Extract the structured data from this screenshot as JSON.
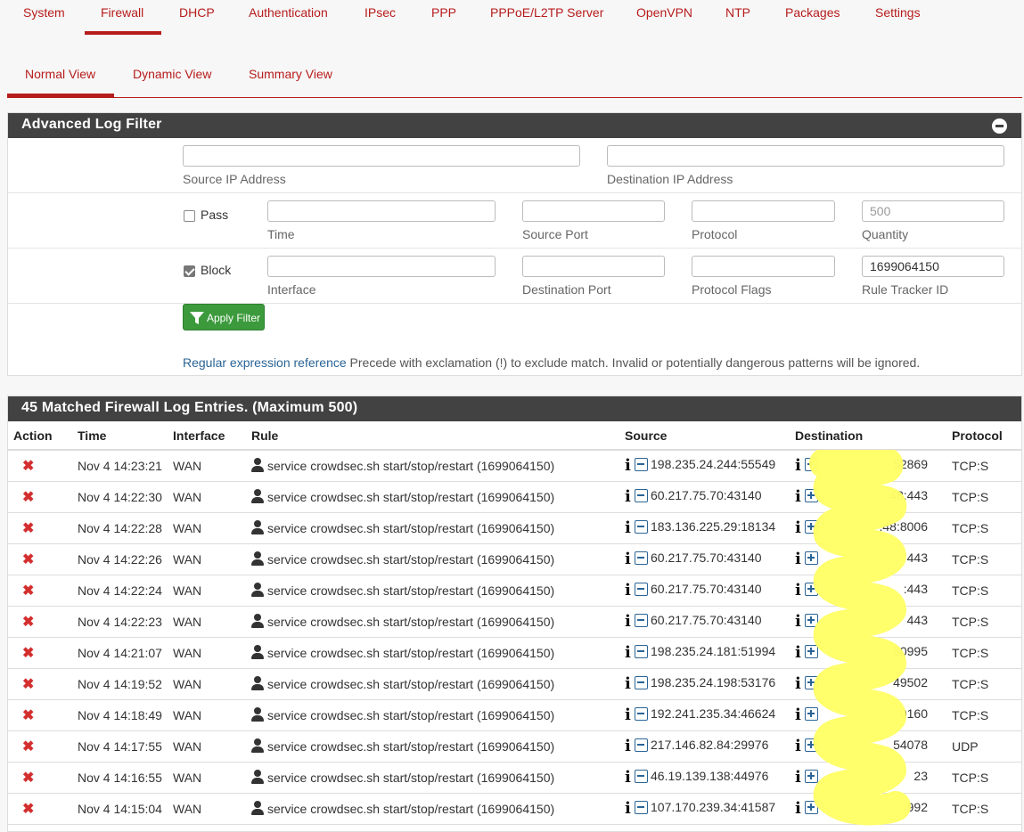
{
  "nav_tabs": [
    "System",
    "Firewall",
    "DHCP",
    "Authentication",
    "IPsec",
    "PPP",
    "PPPoE/L2TP Server",
    "OpenVPN",
    "NTP",
    "Packages",
    "Settings"
  ],
  "view_tabs": [
    "Normal View",
    "Dynamic View",
    "Summary View"
  ],
  "filter_panel": {
    "title": "Advanced Log Filter",
    "source_ip_label": "Source IP Address",
    "destination_ip_label": "Destination IP Address",
    "pass_label": "Pass",
    "pass_checked": false,
    "block_label": "Block",
    "block_checked": true,
    "time_label": "Time",
    "source_port_label": "Source Port",
    "protocol_label": "Protocol",
    "quantity_label": "Quantity",
    "quantity_placeholder": "500",
    "interface_label": "Interface",
    "destination_port_label": "Destination Port",
    "protocol_flags_label": "Protocol Flags",
    "rule_tracker_label": "Rule Tracker ID",
    "rule_tracker_value": "1699064150",
    "apply_label": "Apply Filter",
    "regex_link": "Regular expression reference",
    "help_text": "Precede with exclamation (!) to exclude match. Invalid or potentially dangerous patterns will be ignored."
  },
  "log_panel": {
    "title": "45 Matched Firewall Log Entries. (Maximum 500)",
    "columns": [
      "Action",
      "Time",
      "Interface",
      "Rule",
      "Source",
      "Destination",
      "Protocol"
    ],
    "rows": [
      {
        "time": "Nov 4 14:23:21",
        "interface": "WAN",
        "rule": "service crowdsec.sh start/stop/restart (1699064150)",
        "source": "198.235.24.244:55549",
        "destination": "52869",
        "protocol": "TCP:S"
      },
      {
        "time": "Nov 4 14:22:30",
        "interface": "WAN",
        "rule": "service crowdsec.sh start/stop/restart (1699064150)",
        "source": "60.217.75.70:43140",
        "destination": "48:443",
        "protocol": "TCP:S"
      },
      {
        "time": "Nov 4 14:22:28",
        "interface": "WAN",
        "rule": "service crowdsec.sh start/stop/restart (1699064150)",
        "source": "183.136.225.29:18134",
        "destination": ".48:8006",
        "protocol": "TCP:S"
      },
      {
        "time": "Nov 4 14:22:26",
        "interface": "WAN",
        "rule": "service crowdsec.sh start/stop/restart (1699064150)",
        "source": "60.217.75.70:43140",
        "destination": "443",
        "protocol": "TCP:S"
      },
      {
        "time": "Nov 4 14:22:24",
        "interface": "WAN",
        "rule": "service crowdsec.sh start/stop/restart (1699064150)",
        "source": "60.217.75.70:43140",
        "destination": ":443",
        "protocol": "TCP:S"
      },
      {
        "time": "Nov 4 14:22:23",
        "interface": "WAN",
        "rule": "service crowdsec.sh start/stop/restart (1699064150)",
        "source": "60.217.75.70:43140",
        "destination": "443",
        "protocol": "TCP:S"
      },
      {
        "time": "Nov 4 14:21:07",
        "interface": "WAN",
        "rule": "service crowdsec.sh start/stop/restart (1699064150)",
        "source": "198.235.24.181:51994",
        "destination": "50995",
        "protocol": "TCP:S"
      },
      {
        "time": "Nov 4 14:19:52",
        "interface": "WAN",
        "rule": "service crowdsec.sh start/stop/restart (1699064150)",
        "source": "198.235.24.198:53176",
        "destination": "49502",
        "protocol": "TCP:S"
      },
      {
        "time": "Nov 4 14:18:49",
        "interface": "WAN",
        "rule": "service crowdsec.sh start/stop/restart (1699064150)",
        "source": "192.241.235.34:46624",
        "destination": "0160",
        "protocol": "TCP:S"
      },
      {
        "time": "Nov 4 14:17:55",
        "interface": "WAN",
        "rule": "service crowdsec.sh start/stop/restart (1699064150)",
        "source": "217.146.82.84:29976",
        "destination": "54078",
        "protocol": "UDP"
      },
      {
        "time": "Nov 4 14:16:55",
        "interface": "WAN",
        "rule": "service crowdsec.sh start/stop/restart (1699064150)",
        "source": "46.19.139.138:44976",
        "destination": "23",
        "protocol": "TCP:S"
      },
      {
        "time": "Nov 4 14:15:04",
        "interface": "WAN",
        "rule": "service crowdsec.sh start/stop/restart (1699064150)",
        "source": "107.170.239.34:41587",
        "destination": "992",
        "protocol": "TCP:S"
      }
    ]
  },
  "colors": {
    "accent": "#b71c1c",
    "panel_header": "#424242",
    "apply_button": "#3c9a3c",
    "block_icon": "#d32f2f",
    "redaction": "#ffff66"
  },
  "icons": {
    "action": "block-x-icon",
    "rule": "user-icon",
    "info": "info-icon",
    "source_toggle": "minus-box-icon",
    "destination_toggle": "plus-box-icon"
  }
}
